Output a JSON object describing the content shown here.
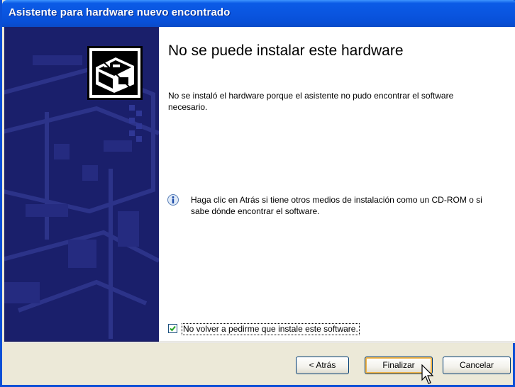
{
  "window": {
    "title": "Asistente para hardware nuevo encontrado"
  },
  "header_icon": "hardware-warning-icon",
  "content": {
    "heading": "No se puede instalar este hardware",
    "description": "No se instaló el hardware porque el asistente no pudo encontrar el software necesario.",
    "info_icon": "info-icon",
    "info_text": "Haga clic en Atrás si tiene otros medios de instalación como un CD-ROM o si sabe dónde encontrar el software."
  },
  "checkbox": {
    "label": "No volver a pedirme que instale este software.",
    "checked": true
  },
  "buttons": {
    "back": "< Atrás",
    "finish": "Finalizar",
    "cancel": "Cancelar"
  },
  "colors": {
    "titlebar": "#0a55e0",
    "side_panel": "#1a1f6b",
    "window_bg": "#ece9d8",
    "check_green": "#21a121"
  }
}
